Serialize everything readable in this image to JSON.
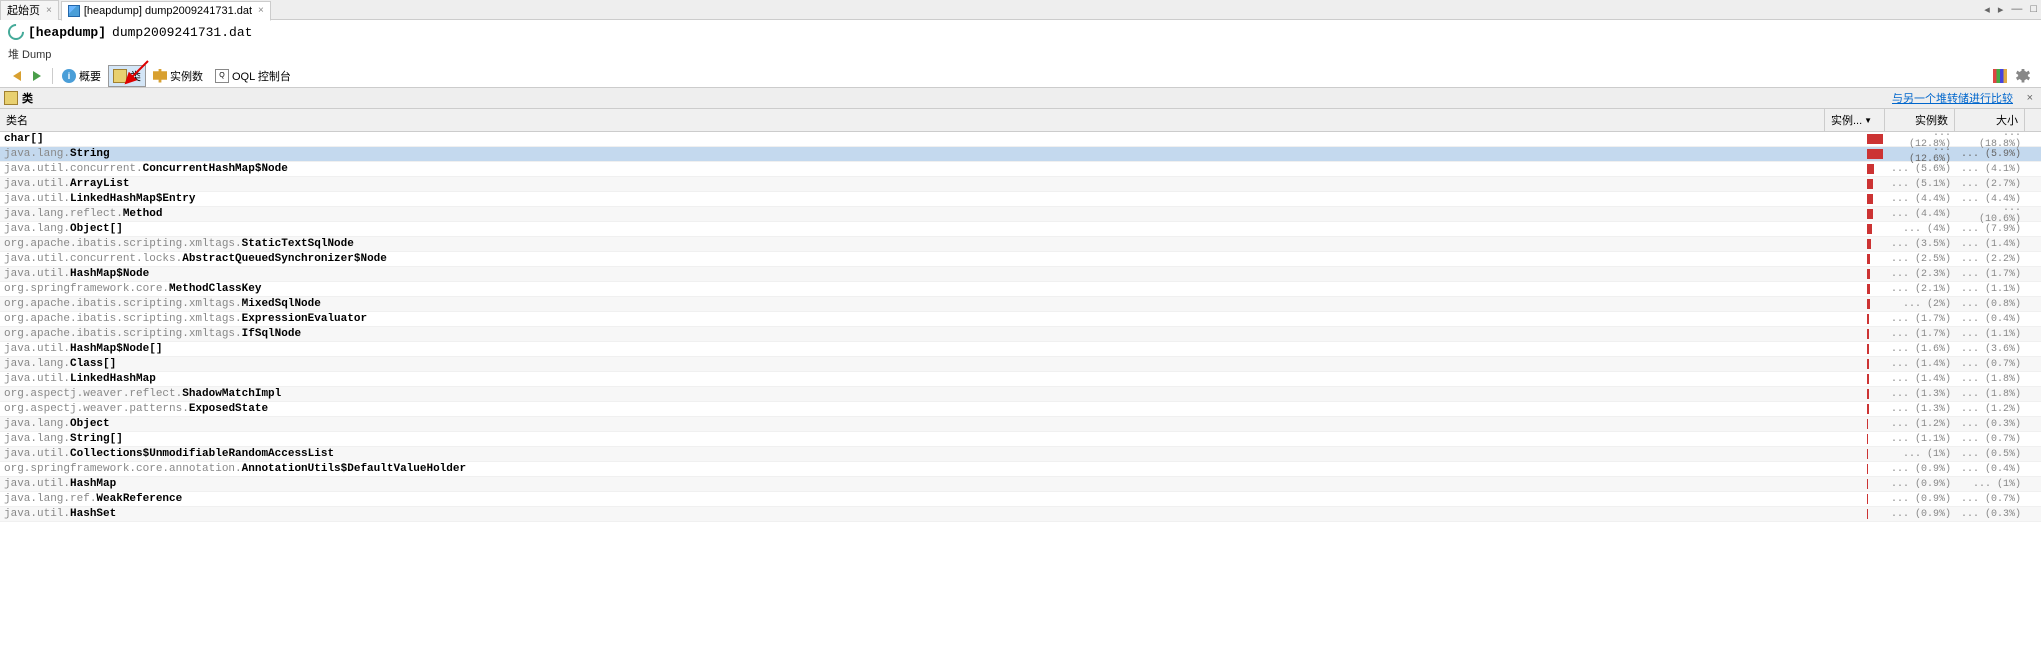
{
  "tabs": {
    "items": [
      {
        "label": "起始页"
      },
      {
        "label": "[heapdump] dump2009241731.dat"
      }
    ]
  },
  "windowControls": {
    "min": "—",
    "max": "□",
    "close": ""
  },
  "title": {
    "bracket": "[heapdump]",
    "filename": "dump2009241731.dat"
  },
  "subLabel": "堆 Dump",
  "toolbar": {
    "overview": "概要",
    "classes": "类",
    "instances": "实例数",
    "oql": "OQL 控制台"
  },
  "section": {
    "label": "类",
    "link": "与另一个堆转储进行比较",
    "close": "×"
  },
  "columns": {
    "name": "类名",
    "inst": "实例...",
    "count": "实例数",
    "size": "大小"
  },
  "rows": [
    {
      "pkg": "",
      "cls": "char[]",
      "bar": 100,
      "pct1": "(12.8%)",
      "pct2": "(18.8%)",
      "sel": false
    },
    {
      "pkg": "java.lang.",
      "cls": "String",
      "bar": 98,
      "pct1": "(12.6%)",
      "pct2": "(5.9%)",
      "sel": true
    },
    {
      "pkg": "java.util.concurrent.",
      "cls": "ConcurrentHashMap$Node",
      "bar": 46,
      "pct1": "(5.6%)",
      "pct2": "(4.1%)",
      "sel": false
    },
    {
      "pkg": "java.util.",
      "cls": "ArrayList",
      "bar": 40,
      "pct1": "(5.1%)",
      "pct2": "(2.7%)",
      "sel": false
    },
    {
      "pkg": "java.util.",
      "cls": "LinkedHashMap$Entry",
      "bar": 35,
      "pct1": "(4.4%)",
      "pct2": "(4.4%)",
      "sel": false
    },
    {
      "pkg": "java.lang.reflect.",
      "cls": "Method",
      "bar": 35,
      "pct1": "(4.4%)",
      "pct2": "(10.6%)",
      "sel": false
    },
    {
      "pkg": "java.lang.",
      "cls": "Object[]",
      "bar": 33,
      "pct1": "(4%)",
      "pct2": "(7.9%)",
      "sel": false
    },
    {
      "pkg": "org.apache.ibatis.scripting.xmltags.",
      "cls": "StaticTextSqlNode",
      "bar": 26,
      "pct1": "(3.5%)",
      "pct2": "(1.4%)",
      "sel": false
    },
    {
      "pkg": "java.util.concurrent.locks.",
      "cls": "AbstractQueuedSynchronizer$Node",
      "bar": 21,
      "pct1": "(2.5%)",
      "pct2": "(2.2%)",
      "sel": false
    },
    {
      "pkg": "java.util.",
      "cls": "HashMap$Node",
      "bar": 18,
      "pct1": "(2.3%)",
      "pct2": "(1.7%)",
      "sel": false
    },
    {
      "pkg": "org.springframework.core.",
      "cls": "MethodClassKey",
      "bar": 17,
      "pct1": "(2.1%)",
      "pct2": "(1.1%)",
      "sel": false
    },
    {
      "pkg": "org.apache.ibatis.scripting.xmltags.",
      "cls": "MixedSqlNode",
      "bar": 16,
      "pct1": "(2%)",
      "pct2": "(0.8%)",
      "sel": false
    },
    {
      "pkg": "org.apache.ibatis.scripting.xmltags.",
      "cls": "ExpressionEvaluator",
      "bar": 14,
      "pct1": "(1.7%)",
      "pct2": "(0.4%)",
      "sel": false
    },
    {
      "pkg": "org.apache.ibatis.scripting.xmltags.",
      "cls": "IfSqlNode",
      "bar": 14,
      "pct1": "(1.7%)",
      "pct2": "(1.1%)",
      "sel": false
    },
    {
      "pkg": "java.util.",
      "cls": "HashMap$Node[]",
      "bar": 13,
      "pct1": "(1.6%)",
      "pct2": "(3.6%)",
      "sel": false
    },
    {
      "pkg": "java.lang.",
      "cls": "Class[]",
      "bar": 11,
      "pct1": "(1.4%)",
      "pct2": "(0.7%)",
      "sel": false
    },
    {
      "pkg": "java.util.",
      "cls": "LinkedHashMap",
      "bar": 11,
      "pct1": "(1.4%)",
      "pct2": "(1.8%)",
      "sel": false
    },
    {
      "pkg": "org.aspectj.weaver.reflect.",
      "cls": "ShadowMatchImpl",
      "bar": 10,
      "pct1": "(1.3%)",
      "pct2": "(1.8%)",
      "sel": false
    },
    {
      "pkg": "org.aspectj.weaver.patterns.",
      "cls": "ExposedState",
      "bar": 10,
      "pct1": "(1.3%)",
      "pct2": "(1.2%)",
      "sel": false
    },
    {
      "pkg": "java.lang.",
      "cls": "Object",
      "bar": 9,
      "pct1": "(1.2%)",
      "pct2": "(0.3%)",
      "sel": false
    },
    {
      "pkg": "java.lang.",
      "cls": "String[]",
      "bar": 9,
      "pct1": "(1.1%)",
      "pct2": "(0.7%)",
      "sel": false
    },
    {
      "pkg": "java.util.",
      "cls": "Collections$UnmodifiableRandomAccessList",
      "bar": 8,
      "pct1": "(1%)",
      "pct2": "(0.5%)",
      "sel": false
    },
    {
      "pkg": "org.springframework.core.annotation.",
      "cls": "AnnotationUtils$DefaultValueHolder",
      "bar": 8,
      "pct1": "(0.9%)",
      "pct2": "(0.4%)",
      "sel": false
    },
    {
      "pkg": "java.util.",
      "cls": "HashMap",
      "bar": 8,
      "pct1": "(0.9%)",
      "pct2": "(1%)",
      "sel": false
    },
    {
      "pkg": "java.lang.ref.",
      "cls": "WeakReference",
      "bar": 7,
      "pct1": "(0.9%)",
      "pct2": "(0.7%)",
      "sel": false
    },
    {
      "pkg": "java.util.",
      "cls": "HashSet",
      "bar": 7,
      "pct1": "(0.9%)",
      "pct2": "(0.3%)",
      "sel": false
    }
  ],
  "ellipsis": "..."
}
